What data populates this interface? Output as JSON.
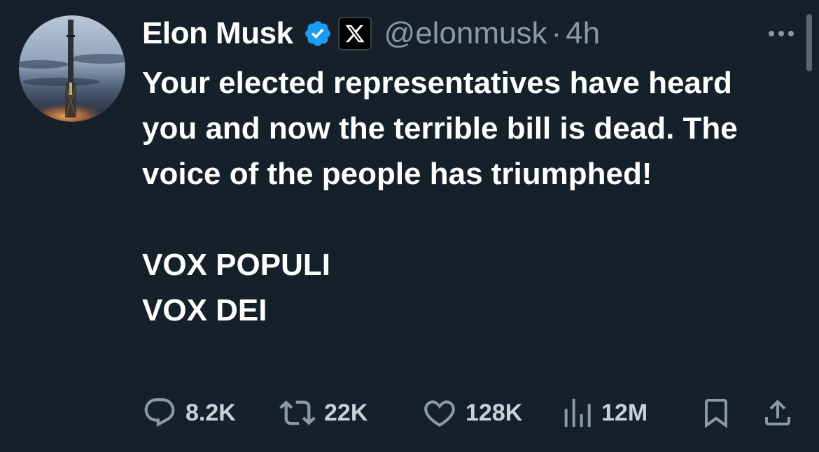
{
  "author": {
    "name": "Elon Musk",
    "handle": "@elonmusk",
    "separator": "·",
    "time": "4h",
    "verified_color": "#1d9bf0",
    "avatar_icon": "starship-avatar",
    "affiliation_icon": "x-logo-icon"
  },
  "tweet": {
    "paragraphs": [
      "Your elected representatives have heard you and now the terrible bill is dead. The voice of the people has triumphed!",
      "VOX POPULI",
      "VOX DEI"
    ]
  },
  "actions": {
    "reply": {
      "icon": "reply-icon",
      "count": "8.2K"
    },
    "retweet": {
      "icon": "retweet-icon",
      "count": "22K"
    },
    "like": {
      "icon": "heart-icon",
      "count": "128K"
    },
    "views": {
      "icon": "views-icon",
      "count": "12M"
    },
    "bookmark": {
      "icon": "bookmark-icon"
    },
    "share": {
      "icon": "share-icon"
    }
  },
  "more_icon": "more-options-icon",
  "colors": {
    "background": "#15202b",
    "text": "#ffffff",
    "secondary": "#8b98a5",
    "accent": "#1d9bf0"
  }
}
